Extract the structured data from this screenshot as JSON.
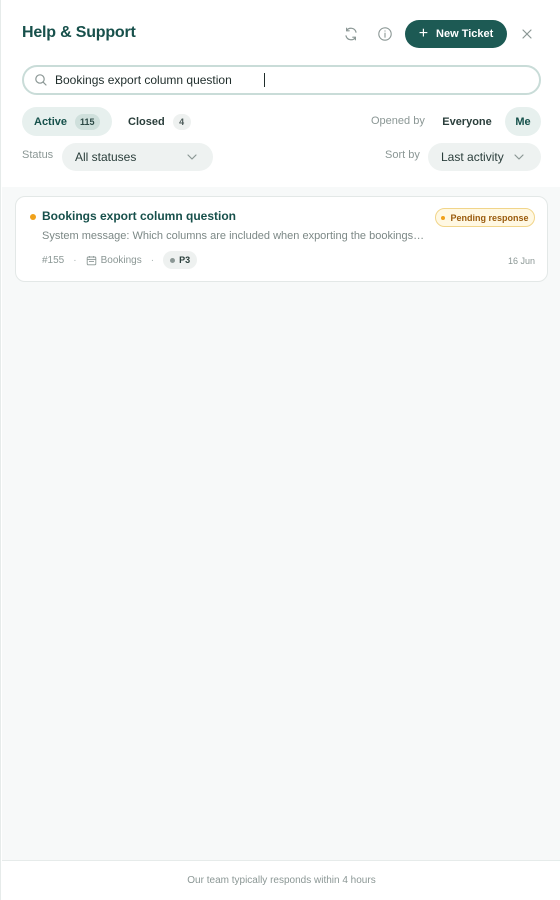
{
  "header": {
    "title": "Help & Support",
    "refresh_icon": "refresh-icon",
    "info_icon": "info-icon",
    "new_ticket_label": "New Ticket",
    "close_icon": "close-icon",
    "brand_color": "#1d5a54"
  },
  "search": {
    "value": "Bookings export column question",
    "icon": "search-icon"
  },
  "tabs": [
    {
      "label": "Active",
      "count": "115",
      "selected": true
    },
    {
      "label": "Closed",
      "count": "4",
      "selected": false
    }
  ],
  "opened_by": {
    "label": "Opened by",
    "options": [
      "Everyone",
      "Me"
    ],
    "selected": "Me"
  },
  "filters": {
    "status_label": "Status",
    "status_value": "All statuses",
    "sort_label": "Sort by",
    "sort_value": "Last activity"
  },
  "tickets": [
    {
      "title": "Bookings export column question",
      "status": "Pending response",
      "status_color": "#f0a11a",
      "preview": "System message: Which columns are included when exporting the bookings list?",
      "id": "#155",
      "category": "Bookings",
      "category_icon": "calendar-icon",
      "priority": "P3",
      "date": "16 Jun",
      "unread": true
    }
  ],
  "footer": {
    "text": "Our team typically responds within 4 hours"
  }
}
